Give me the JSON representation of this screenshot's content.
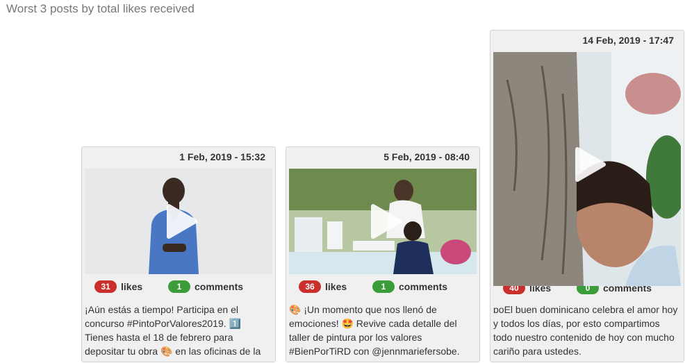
{
  "section_title": "Worst 3 posts by total likes received",
  "posts": [
    {
      "date": "1 Feb, 2019 - 15:32",
      "likes": "31",
      "likes_label": "likes",
      "comments": "1",
      "comments_label": "comments",
      "caption_lines": [
        "¡Aún estás a tiempo! Participa en el",
        "concurso #PintoPorValores2019. 1️⃣",
        "Tienes hasta el 18 de febrero para",
        "depositar tu obra 🎨 en las oficinas de la"
      ]
    },
    {
      "date": "5 Feb, 2019 - 08:40",
      "likes": "36",
      "likes_label": "likes",
      "comments": "1",
      "comments_label": "comments",
      "caption_lines": [
        "🎨 ¡Un momento que nos llenó de",
        "emociones! 🤩 Revive cada detalle del",
        "taller de pintura por los valores",
        "#BienPorTiRD con @jennmariefersobe."
      ]
    },
    {
      "date": "14 Feb, 2019 - 17:47",
      "likes": "40",
      "likes_label": "likes",
      "comments": "0",
      "comments_label": "comments",
      "caption_lines": [
        "ɒoEl buen dominicano celebra el amor hoy",
        "y todos los días, por esto compartimos",
        "todo nuestro contenido de hoy con mucho",
        "cariño para ustedes."
      ]
    }
  ],
  "colors": {
    "likes_badge": "#c9302c",
    "comments_badge": "#3a9d3a"
  },
  "icons": {
    "play": "play-icon"
  }
}
